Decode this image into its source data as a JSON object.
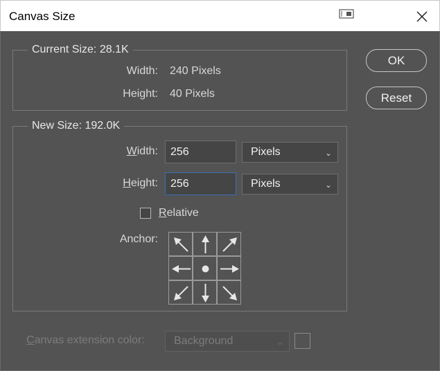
{
  "window": {
    "title": "Canvas Size"
  },
  "current_size": {
    "legend": "Current Size: 28.1K",
    "width_label": "Width:",
    "width_value": "240 Pixels",
    "height_label": "Height:",
    "height_value": "40 Pixels"
  },
  "new_size": {
    "legend": "New Size: 192.0K",
    "width_label_u": "W",
    "width_label_rest": "idth:",
    "width_value": "256",
    "width_unit": "Pixels",
    "height_label_u": "H",
    "height_label_rest": "eight:",
    "height_value": "256",
    "height_unit": "Pixels",
    "relative_label_u": "R",
    "relative_label_rest": "elative",
    "relative_checked": false,
    "anchor_label": "Anchor:",
    "anchor_selected": "center"
  },
  "buttons": {
    "ok": "OK",
    "reset": "Reset"
  },
  "extension": {
    "label_u": "C",
    "label_rest": "anvas extension color:",
    "value": "Background",
    "swatch_color": "#535353"
  },
  "colors": {
    "background": "#535353",
    "focus_border": "#3d6fb5",
    "border": "#7a7a7a"
  }
}
